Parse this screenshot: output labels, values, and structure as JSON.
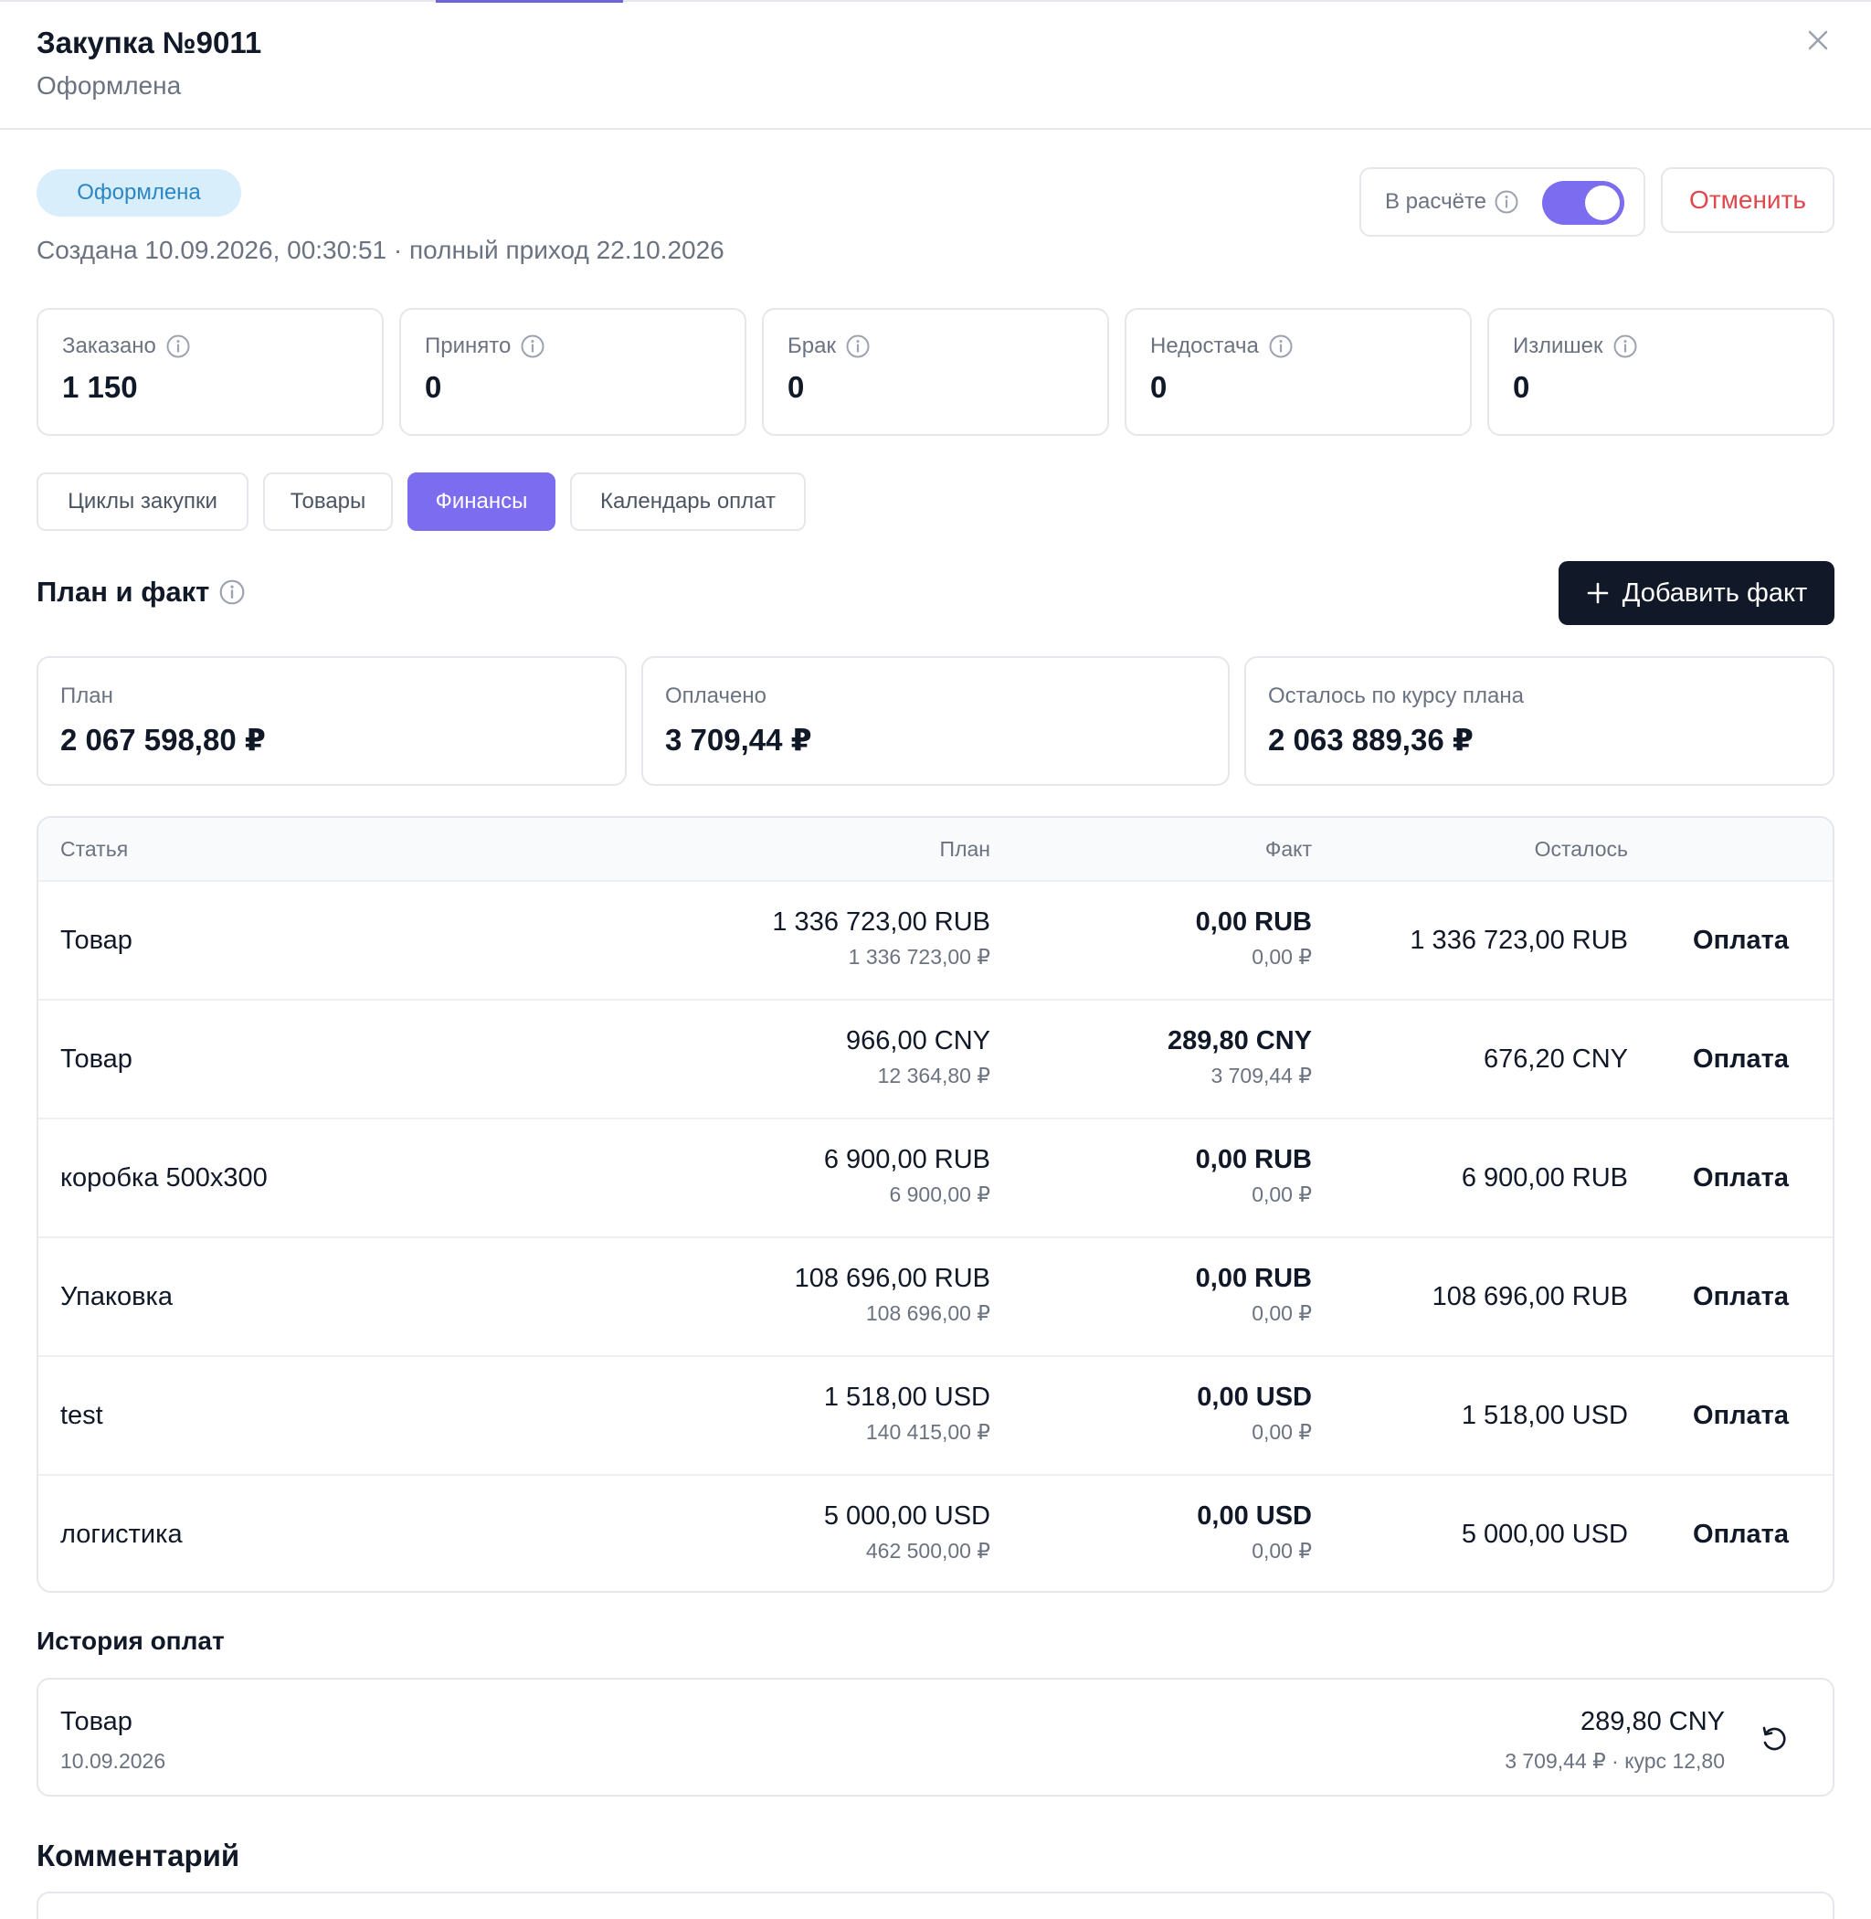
{
  "header": {
    "title": "Закупка №9011",
    "subtitle": "Оформлена"
  },
  "status_badge": "Оформлена",
  "created_line": "Создана 10.09.2026, 00:30:51 · полный приход 22.10.2026",
  "toggle": {
    "label": "В расчёте",
    "on": true
  },
  "cancel_label": "Отменить",
  "stats": [
    {
      "label": "Заказано",
      "value": "1 150"
    },
    {
      "label": "Принято",
      "value": "0"
    },
    {
      "label": "Брак",
      "value": "0"
    },
    {
      "label": "Недостача",
      "value": "0"
    },
    {
      "label": "Излишек",
      "value": "0"
    }
  ],
  "tabs": [
    {
      "label": "Циклы закупки",
      "active": false
    },
    {
      "label": "Товары",
      "active": false
    },
    {
      "label": "Финансы",
      "active": true
    },
    {
      "label": "Календарь оплат",
      "active": false
    }
  ],
  "plan_fact": {
    "title": "План и факт",
    "add_label": "Добавить факт"
  },
  "summary": [
    {
      "label": "План",
      "value": "2 067 598,80 ₽"
    },
    {
      "label": "Оплачено",
      "value": "3 709,44 ₽"
    },
    {
      "label": "Осталось по курсу плана",
      "value": "2 063 889,36 ₽"
    }
  ],
  "table": {
    "columns": {
      "item": "Статья",
      "plan": "План",
      "fact": "Факт",
      "rest": "Осталось"
    },
    "action_label": "Оплата",
    "rows": [
      {
        "name": "Товар",
        "plan": "1 336 723,00 RUB",
        "plan_rub": "1 336 723,00 ₽",
        "fact": "0,00 RUB",
        "fact_rub": "0,00 ₽",
        "rest": "1 336 723,00 RUB"
      },
      {
        "name": "Товар",
        "plan": "966,00 CNY",
        "plan_rub": "12 364,80 ₽",
        "fact": "289,80 CNY",
        "fact_rub": "3 709,44 ₽",
        "rest": "676,20 CNY"
      },
      {
        "name": "коробка 500x300",
        "plan": "6 900,00 RUB",
        "plan_rub": "6 900,00 ₽",
        "fact": "0,00 RUB",
        "fact_rub": "0,00 ₽",
        "rest": "6 900,00 RUB"
      },
      {
        "name": "Упаковка",
        "plan": "108 696,00 RUB",
        "plan_rub": "108 696,00 ₽",
        "fact": "0,00 RUB",
        "fact_rub": "0,00 ₽",
        "rest": "108 696,00 RUB"
      },
      {
        "name": "test",
        "plan": "1 518,00 USD",
        "plan_rub": "140 415,00 ₽",
        "fact": "0,00 USD",
        "fact_rub": "0,00 ₽",
        "rest": "1 518,00 USD"
      },
      {
        "name": "логистика",
        "plan": "5 000,00 USD",
        "plan_rub": "462 500,00 ₽",
        "fact": "0,00 USD",
        "fact_rub": "0,00 ₽",
        "rest": "5 000,00 USD"
      }
    ]
  },
  "history": {
    "title": "История оплат",
    "items": [
      {
        "name": "Товар",
        "date": "10.09.2026",
        "amount": "289,80 CNY",
        "detail": "3 709,44 ₽ · курс 12,80"
      }
    ]
  },
  "comment": {
    "title": "Комментарий"
  },
  "colors": {
    "accent": "#7b6cf0",
    "danger": "#e0484e",
    "badge_bg": "#d9eefb",
    "badge_text": "#2b86c5",
    "dark": "#111827"
  }
}
